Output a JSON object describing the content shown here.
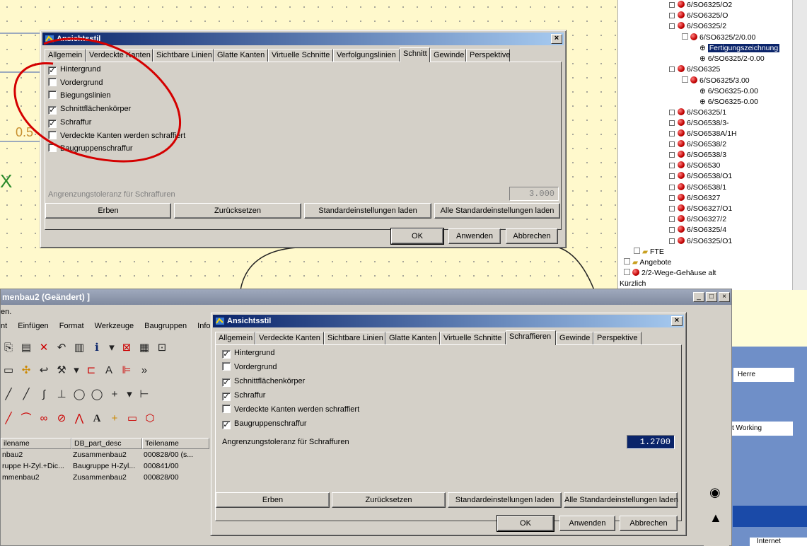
{
  "top_dialog": {
    "title": "Ansichtsstil",
    "tabs": [
      "Allgemein",
      "Verdeckte Kanten",
      "Sichtbare Linien",
      "Glatte Kanten",
      "Virtuelle Schnitte",
      "Verfolgungslinien",
      "Schnitt",
      "Gewinde",
      "Perspektive"
    ],
    "active_tab": "Schnitt",
    "checkboxes": [
      {
        "label": "Hintergrund",
        "checked": true
      },
      {
        "label": "Vordergrund",
        "checked": false
      },
      {
        "label": "Biegungslinien",
        "checked": false
      },
      {
        "label": "Schnittflächenkörper",
        "checked": true
      },
      {
        "label": "Schraffur",
        "checked": true
      },
      {
        "label": "Verdeckte Kanten werden schraffiert",
        "checked": false
      },
      {
        "label": "Baugruppenschraffur",
        "checked": false
      }
    ],
    "tolerance_label": "Angrenzungstoleranz für Schraffuren",
    "tolerance_value": "3.000",
    "buttons": [
      "Erben",
      "Zurücksetzen",
      "Standardeinstellungen laden",
      "Alle Standardeinstellungen laden"
    ],
    "ok": "OK",
    "apply": "Anwenden",
    "cancel": "Abbrechen"
  },
  "bottom_dialog": {
    "title": "Ansichtsstil",
    "tabs": [
      "Allgemein",
      "Verdeckte Kanten",
      "Sichtbare Linien",
      "Glatte Kanten",
      "Virtuelle Schnitte",
      "Schraffieren",
      "Gewinde",
      "Perspektive"
    ],
    "active_tab": "Schraffieren",
    "checkboxes": [
      {
        "label": "Hintergrund",
        "checked": true
      },
      {
        "label": "Vordergrund",
        "checked": false
      },
      {
        "label": "Schnittflächenkörper",
        "checked": true
      },
      {
        "label": "Schraffur",
        "checked": true
      },
      {
        "label": "Verdeckte Kanten werden schraffiert",
        "checked": false
      },
      {
        "label": "Baugruppenschraffur",
        "checked": true
      }
    ],
    "tolerance_label": "Angrenzungstoleranz für Schraffuren",
    "tolerance_value": "1.2700",
    "buttons": [
      "Erben",
      "Zurücksetzen",
      "Standardeinstellungen laden",
      "Alle Standardeinstellungen laden"
    ],
    "ok": "OK",
    "apply": "Anwenden",
    "cancel": "Abbrechen"
  },
  "assembly_window": {
    "title": "menbau2  (Geändert) ]",
    "status_fragment": "en.",
    "menu": [
      "nt",
      "Einfügen",
      "Format",
      "Werkzeuge",
      "Baugruppen",
      "Informa"
    ],
    "columns": [
      "ilename",
      "DB_part_desc",
      "Teilename"
    ],
    "rows": [
      [
        "nbau2",
        "Zusammenbau2",
        "000828/00 (s..."
      ],
      [
        "ruppe H-Zyl.+Dic...",
        "Baugruppe H-Zyl...",
        "000841/00"
      ],
      [
        "mmenbau2",
        "Zusammenbau2",
        "000828/00"
      ]
    ]
  },
  "tree": {
    "items": [
      "6/SO6325/O2",
      "6/SO6325/O",
      "6/SO6325/2",
      "6/SO6325/2/0.00",
      "Fertigungszeichnung",
      "6/SO6325/2-0.00",
      "6/SO6325",
      "6/SO6325/3.00",
      "6/SO6325-0.00",
      "6/SO6325-0.00",
      "6/SO6325/1",
      "6/SO6538/3-",
      "6/SO6538A/1H",
      "6/SO6538/2",
      "6/SO6538/3",
      "6/SO6530",
      "6/SO6538/O1",
      "6/SO6538/1",
      "6/SO6327",
      "6/SO6327/O1",
      "6/SO6327/2",
      "6/SO6325/4",
      "6/SO6325/O1",
      "FTE",
      "Angebote",
      "2/2-Wege-Gehäuse alt",
      "Kürzlich"
    ]
  },
  "right_fragments": {
    "field1": "Herre",
    "working": "t Working",
    "internet": "Internet"
  },
  "colors": {
    "annotation": "#d40000",
    "title_active": "#0a246a",
    "dialog_face": "#d4d0c8"
  }
}
